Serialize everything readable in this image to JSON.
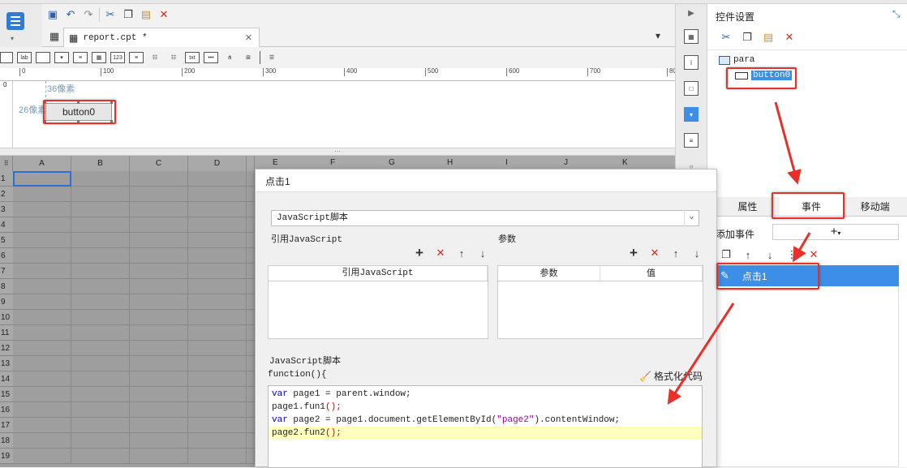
{
  "designer": {
    "doc_tab": "report.cpt *",
    "ruler_ticks": [
      "0",
      "100",
      "200",
      "300",
      "400",
      "500",
      "600",
      "700",
      "80"
    ],
    "vruler_label": "0",
    "height_label": "36像素",
    "width_label": "26像素",
    "button_label": "button0",
    "columns": [
      "A",
      "B",
      "C",
      "D",
      "E",
      "F",
      "G",
      "H",
      "I",
      "J",
      "K"
    ],
    "rows": [
      "1",
      "2",
      "3",
      "4",
      "5",
      "6",
      "7",
      "8",
      "9",
      "10",
      "11",
      "12",
      "13",
      "14",
      "15",
      "16",
      "17",
      "18",
      "19"
    ]
  },
  "toolbar2_icons": [
    "lab",
    "123",
    "txt",
    "•••"
  ],
  "dialog": {
    "title": "点击1",
    "script_type": "JavaScript脚本",
    "ref_js_label": "引用JavaScript",
    "params_label": "参数",
    "ref_js_header": "引用JavaScript",
    "param_col": "参数",
    "value_col": "值",
    "script_label": "JavaScript脚本",
    "function_sig": "function(){",
    "format_code": "格式化代码",
    "code": {
      "l1_kw": "var",
      "l1_rest": " page1 = parent.window;",
      "l2_a": "page1.fun1",
      "l2_b": "();",
      "l3_kw": "var",
      "l3_a": " page2 = page1.document.getElementById(",
      "l3_str": "\"page2\"",
      "l3_b": ").contentWindow;",
      "l4_a": "page2.fun2",
      "l4_b": "();"
    }
  },
  "right_panel": {
    "title": "控件设置",
    "tree_root": "para",
    "tree_child": "button0",
    "tabs": [
      "属性",
      "事件",
      "移动端"
    ],
    "add_event_label": "添加事件",
    "event_item": "点击1"
  },
  "colors": {
    "selection": "#3d8ee6",
    "annotation": "#e8302a"
  }
}
